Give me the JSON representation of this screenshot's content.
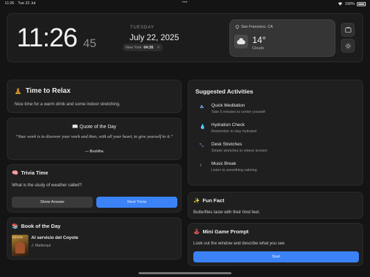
{
  "status_bar": {
    "time": "11:26",
    "date": "Tue 22 Jul",
    "dots": "•••",
    "battery": "100%"
  },
  "clock": {
    "time": "11:26",
    "seconds": "45",
    "day": "TUESDAY",
    "date": "July 22, 2025",
    "timezone": {
      "city": "New York",
      "time": "04:26",
      "close": "✕"
    }
  },
  "weather": {
    "location": "San Francisco, CA",
    "temp": "14°",
    "desc": "Clouds"
  },
  "relax": {
    "title": "Time to Relax",
    "text": "Nice time for a warm drink and some indoor stretching."
  },
  "quote": {
    "title": "Quote of the Day",
    "text": "“Your work is to discover your work and then, with all your heart, to give yourself to it.”",
    "author": "— Buddha"
  },
  "trivia": {
    "title": "Trivia Time",
    "question": "What is the study of weather called?",
    "show_answer": "Show Answer",
    "next": "Next Trivia"
  },
  "book": {
    "title": "Book of the Day",
    "book_title": "Al servicio del Coyote",
    "author": "J. Mallorquí"
  },
  "suggested": {
    "title": "Suggested Activities",
    "items": [
      {
        "title": "Quick Meditation",
        "desc": "Take 5 minutes to center yourself",
        "icon": "☘"
      },
      {
        "title": "Hydration Check",
        "desc": "Remember to stay hydrated",
        "icon": "💧"
      },
      {
        "title": "Desk Stretches",
        "desc": "Simple stretches to relieve tension",
        "icon": "⤡"
      },
      {
        "title": "Music Break",
        "desc": "Listen to something calming",
        "icon": "♪"
      }
    ]
  },
  "fun_fact": {
    "title": "Fun Fact",
    "text": "Butterflies taste with their hind feet."
  },
  "mini_game": {
    "title": "Mini Game Prompt",
    "text": "Look out the window and describe what you see",
    "start": "Start"
  }
}
